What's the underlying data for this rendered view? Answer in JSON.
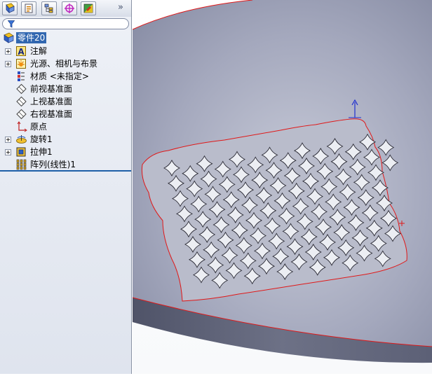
{
  "feature_manager": {
    "tabs": [
      {
        "icon": "feature-manager-tree-icon"
      },
      {
        "icon": "property-manager-icon"
      },
      {
        "icon": "configuration-manager-icon"
      },
      {
        "icon": "dimxpert-manager-icon"
      },
      {
        "icon": "display-manager-icon"
      }
    ],
    "expand_glyph": "»",
    "root": {
      "label": "零件20",
      "icon": "part-icon"
    },
    "items": [
      {
        "label": "注解",
        "icon": "annotations-icon",
        "expandable": true
      },
      {
        "label": "光源、相机与布景",
        "icon": "lights-cameras-icon",
        "expandable": true
      },
      {
        "label": "材质 <未指定>",
        "icon": "material-icon",
        "expandable": false
      },
      {
        "label": "前视基准面",
        "icon": "plane-icon",
        "expandable": false
      },
      {
        "label": "上视基准面",
        "icon": "plane-icon",
        "expandable": false
      },
      {
        "label": "右视基准面",
        "icon": "plane-icon",
        "expandable": false
      },
      {
        "label": "原点",
        "icon": "origin-icon",
        "expandable": false
      },
      {
        "label": "旋转1",
        "icon": "revolve-icon",
        "expandable": true
      },
      {
        "label": "拉伸1",
        "icon": "extrude-icon",
        "expandable": true
      },
      {
        "label": "阵列(线性)1",
        "icon": "linear-pattern-icon",
        "expandable": false
      }
    ]
  },
  "viewport": {
    "colors": {
      "disk_top": "#9aa0b6",
      "disk_side": "#676c80",
      "edge": "#e01818",
      "sketch": "#ffffff"
    }
  }
}
